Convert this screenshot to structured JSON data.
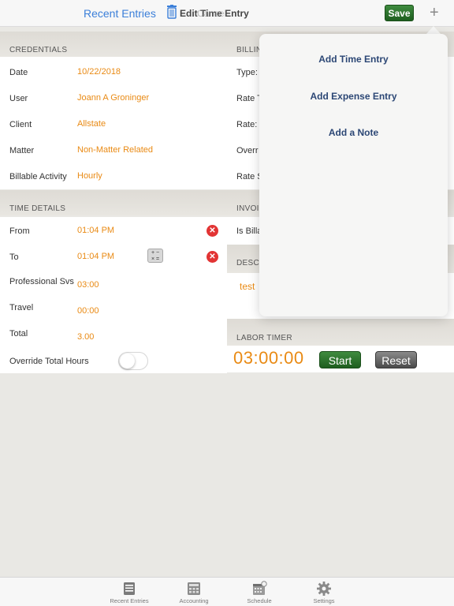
{
  "nav": {
    "back_label": "Recent Entries",
    "title": "Edit Time Entry",
    "title_ghost": "Cancel",
    "save_label": "Save",
    "plus_label": "+"
  },
  "credentials": {
    "header": "CREDENTIALS",
    "rows": [
      {
        "label": "Date",
        "value": "10/22/2018"
      },
      {
        "label": "User",
        "value": "Joann A Groninger"
      },
      {
        "label": "Client",
        "value": "Allstate"
      },
      {
        "label": "Matter",
        "value": "Non-Matter Related"
      },
      {
        "label": "Billable Activity",
        "value": "Hourly"
      }
    ]
  },
  "billing": {
    "header": "BILLIN",
    "rows": [
      {
        "label": "Type:"
      },
      {
        "label": "Rate T"
      },
      {
        "label": "Rate:"
      },
      {
        "label": "Overr"
      },
      {
        "label": "Rate S"
      }
    ]
  },
  "time_details": {
    "header": "TIME DETAILS",
    "rows": [
      {
        "label": "From",
        "value": "01:04 PM"
      },
      {
        "label": "To",
        "value": "01:04 PM"
      },
      {
        "label": "Professional Svs",
        "value": "03:00"
      },
      {
        "label": "Travel",
        "value": "00:00"
      },
      {
        "label": "Total",
        "value": "3.00"
      },
      {
        "label": "Override Total Hours",
        "value": ""
      }
    ],
    "clear_symbol": "✕",
    "calc_symbol": "+ −\n× ="
  },
  "invoice": {
    "header": "INVOIC",
    "row_label": "Is Billa"
  },
  "description": {
    "header": "DESCR",
    "value": "test"
  },
  "labor_timer": {
    "header": "LABOR TIMER",
    "time": "03:00:00",
    "start_label": "Start",
    "reset_label": "Reset"
  },
  "popover": {
    "items": [
      "Add Time Entry",
      "Add Expense Entry",
      "Add a Note"
    ]
  },
  "tabbar": {
    "tabs": [
      {
        "label": "Recent Entries",
        "icon": "list-icon"
      },
      {
        "label": "Accounting",
        "icon": "calculator-icon"
      },
      {
        "label": "Schedule",
        "icon": "calendar-icon"
      },
      {
        "label": "Settings",
        "icon": "gear-icon"
      }
    ]
  },
  "colors": {
    "accent": "#e98a14",
    "link": "#3b7fd9",
    "save_green": "#2e7a2f",
    "popover_text": "#2c4775"
  }
}
